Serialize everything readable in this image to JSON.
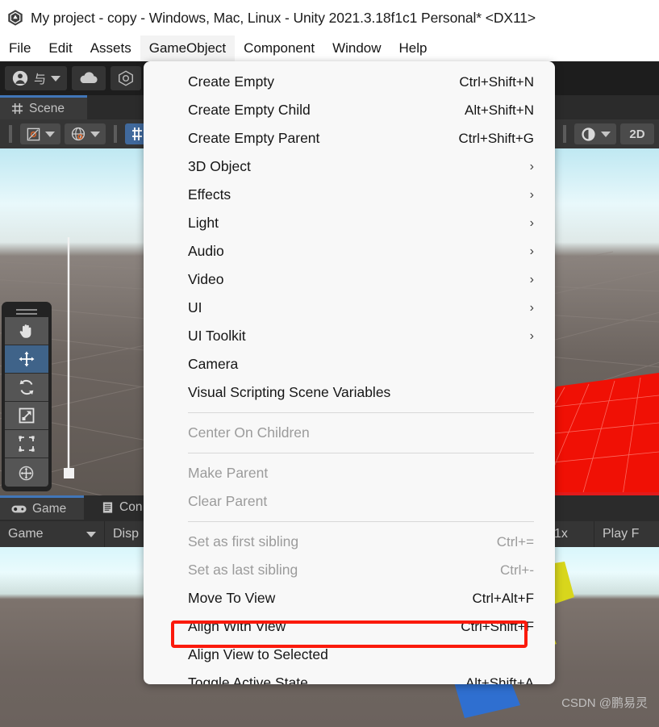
{
  "window": {
    "title": "My project - copy - Windows, Mac, Linux - Unity 2021.3.18f1c1 Personal* <DX11>",
    "logo_icon": "unity-logo-icon"
  },
  "menubar": {
    "items": [
      {
        "label": "File",
        "active": false
      },
      {
        "label": "Edit",
        "active": false
      },
      {
        "label": "Assets",
        "active": false
      },
      {
        "label": "GameObject",
        "active": true
      },
      {
        "label": "Component",
        "active": false
      },
      {
        "label": "Window",
        "active": false
      },
      {
        "label": "Help",
        "active": false
      }
    ]
  },
  "global_toolbar": {
    "account_label": "与",
    "account_icon": "account-icon",
    "cloud_icon": "cloud-icon",
    "collab_icon": "package-icon"
  },
  "scene_panel": {
    "tab_label": "Scene",
    "tab_icon": "scene-grid-icon",
    "toolbar": {
      "pivot_label": "Pivot",
      "pivot_icon": "pivot-icon",
      "handle_label": "Global",
      "handle_icon": "globe-icon",
      "grid_snap_icon": "grid-snap-icon",
      "lighting_icon": "lighting-toggle-icon",
      "view_mode_label": "2D"
    },
    "tools": [
      {
        "name": "hand-tool",
        "icon": "hand-icon",
        "active": false
      },
      {
        "name": "move-tool",
        "icon": "move-arrows-icon",
        "active": true
      },
      {
        "name": "rotate-tool",
        "icon": "rotate-icon",
        "active": false
      },
      {
        "name": "scale-tool",
        "icon": "scale-icon",
        "active": false
      },
      {
        "name": "rect-tool",
        "icon": "rect-transform-icon",
        "active": false
      },
      {
        "name": "transform-tool",
        "icon": "transform-icon",
        "active": false
      }
    ]
  },
  "bottom_panel": {
    "tabs": [
      {
        "label": "Game",
        "icon": "gamepad-icon",
        "selected": true
      },
      {
        "label": "Con",
        "icon": "console-icon",
        "selected": false
      }
    ],
    "toolbar": {
      "view_select": "Game",
      "display_label": "Disp",
      "scale_label": "1x",
      "play_mode_label": "Play F"
    }
  },
  "dropdown": {
    "items": [
      {
        "label": "Create Empty",
        "shortcut": "Ctrl+Shift+N",
        "submenu": false,
        "disabled": false,
        "separator_before": false,
        "highlighted": false
      },
      {
        "label": "Create Empty Child",
        "shortcut": "Alt+Shift+N",
        "submenu": false,
        "disabled": false,
        "separator_before": false,
        "highlighted": false
      },
      {
        "label": "Create Empty Parent",
        "shortcut": "Ctrl+Shift+G",
        "submenu": false,
        "disabled": false,
        "separator_before": false,
        "highlighted": false
      },
      {
        "label": "3D Object",
        "shortcut": "",
        "submenu": true,
        "disabled": false,
        "separator_before": false,
        "highlighted": false
      },
      {
        "label": "Effects",
        "shortcut": "",
        "submenu": true,
        "disabled": false,
        "separator_before": false,
        "highlighted": false
      },
      {
        "label": "Light",
        "shortcut": "",
        "submenu": true,
        "disabled": false,
        "separator_before": false,
        "highlighted": false
      },
      {
        "label": "Audio",
        "shortcut": "",
        "submenu": true,
        "disabled": false,
        "separator_before": false,
        "highlighted": false
      },
      {
        "label": "Video",
        "shortcut": "",
        "submenu": true,
        "disabled": false,
        "separator_before": false,
        "highlighted": false
      },
      {
        "label": "UI",
        "shortcut": "",
        "submenu": true,
        "disabled": false,
        "separator_before": false,
        "highlighted": false
      },
      {
        "label": "UI Toolkit",
        "shortcut": "",
        "submenu": true,
        "disabled": false,
        "separator_before": false,
        "highlighted": false
      },
      {
        "label": "Camera",
        "shortcut": "",
        "submenu": false,
        "disabled": false,
        "separator_before": false,
        "highlighted": false
      },
      {
        "label": "Visual Scripting Scene Variables",
        "shortcut": "",
        "submenu": false,
        "disabled": false,
        "separator_before": false,
        "highlighted": false
      },
      {
        "label": "Center On Children",
        "shortcut": "",
        "submenu": false,
        "disabled": true,
        "separator_before": true,
        "highlighted": false
      },
      {
        "label": "Make Parent",
        "shortcut": "",
        "submenu": false,
        "disabled": true,
        "separator_before": true,
        "highlighted": false
      },
      {
        "label": "Clear Parent",
        "shortcut": "",
        "submenu": false,
        "disabled": true,
        "separator_before": false,
        "highlighted": false
      },
      {
        "label": "Set as first sibling",
        "shortcut": "Ctrl+=",
        "submenu": false,
        "disabled": true,
        "separator_before": true,
        "highlighted": false
      },
      {
        "label": "Set as last sibling",
        "shortcut": "Ctrl+-",
        "submenu": false,
        "disabled": true,
        "separator_before": false,
        "highlighted": false
      },
      {
        "label": "Move To View",
        "shortcut": "Ctrl+Alt+F",
        "submenu": false,
        "disabled": false,
        "separator_before": false,
        "highlighted": false
      },
      {
        "label": "Align With View",
        "shortcut": "Ctrl+Shift+F",
        "submenu": false,
        "disabled": false,
        "separator_before": false,
        "highlighted": false
      },
      {
        "label": "Align View to Selected",
        "shortcut": "",
        "submenu": false,
        "disabled": false,
        "separator_before": false,
        "highlighted": true
      },
      {
        "label": "Toggle Active State",
        "shortcut": "Alt+Shift+A",
        "submenu": false,
        "disabled": false,
        "separator_before": false,
        "highlighted": false
      }
    ],
    "submenu_glyph": "›",
    "highlight_color": "#fb1a0c"
  },
  "watermark": {
    "text": "CSDN @鹏易灵"
  }
}
